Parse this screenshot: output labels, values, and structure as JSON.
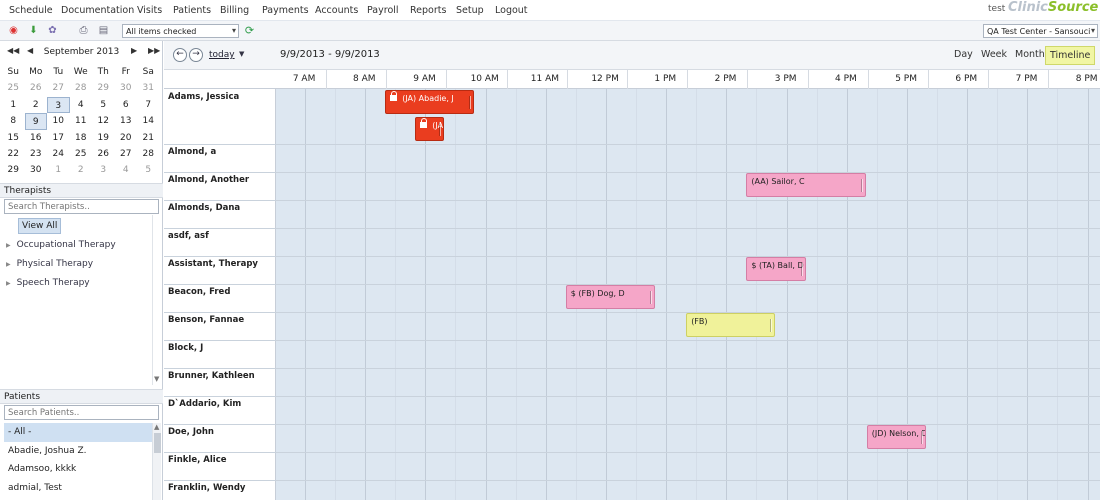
{
  "menu": {
    "items": [
      "Schedule",
      "Documentation",
      "Visits",
      "Patients",
      "Billing",
      "Payments",
      "Accounts",
      "Payroll",
      "Reports",
      "Setup",
      "Logout"
    ]
  },
  "header": {
    "user": "test",
    "logo_part1": "Clinic",
    "logo_part2": "Source"
  },
  "toolbar": {
    "filter_value": "All items checked",
    "center_value": "QA Test Center - Sansouci"
  },
  "calendar": {
    "month_label": "September 2013",
    "day_headers": [
      "Su",
      "Mo",
      "Tu",
      "We",
      "Th",
      "Fr",
      "Sa"
    ],
    "weeks": [
      [
        "25",
        "26",
        "27",
        "28",
        "29",
        "30",
        "31"
      ],
      [
        "1",
        "2",
        "3",
        "4",
        "5",
        "6",
        "7"
      ],
      [
        "8",
        "9",
        "10",
        "11",
        "12",
        "13",
        "14"
      ],
      [
        "15",
        "16",
        "17",
        "18",
        "19",
        "20",
        "21"
      ],
      [
        "22",
        "23",
        "24",
        "25",
        "26",
        "27",
        "28"
      ],
      [
        "29",
        "30",
        "1",
        "2",
        "3",
        "4",
        "5"
      ]
    ]
  },
  "therapists": {
    "heading": "Therapists",
    "search_placeholder": "Search Therapists..",
    "view_all": "View All",
    "groups": [
      "Occupational Therapy",
      "Physical Therapy",
      "Speech Therapy"
    ]
  },
  "patients": {
    "heading": "Patients",
    "search_placeholder": "Search Patients..",
    "items": [
      "- All -",
      "Abadie, Joshua Z.",
      "Adamsoo, kkkk",
      "admial, Test"
    ]
  },
  "schedule": {
    "today_label": "today",
    "date_range": "9/9/2013 - 9/9/2013",
    "views": [
      "Day",
      "Week",
      "Month",
      "Timeline"
    ],
    "active_view": "Timeline",
    "hours": [
      "7 AM",
      "8 AM",
      "9 AM",
      "10 AM",
      "11 AM",
      "12 PM",
      "1 PM",
      "2 PM",
      "3 PM",
      "4 PM",
      "5 PM",
      "6 PM",
      "7 PM",
      "8 PM"
    ],
    "rows": [
      {
        "name": "Adams, Jessica",
        "tall": true
      },
      {
        "name": "Almond, a"
      },
      {
        "name": "Almond, Another"
      },
      {
        "name": "Almonds, Dana"
      },
      {
        "name": "asdf, asf"
      },
      {
        "name": "Assistant, Therapy"
      },
      {
        "name": "Beacon, Fred"
      },
      {
        "name": "Benson, Fannae"
      },
      {
        "name": "Block, J"
      },
      {
        "name": "Brunner, Kathleen"
      },
      {
        "name": "D`Addario, Kim"
      },
      {
        "name": "Doe, John"
      },
      {
        "name": "Finkle, Alice"
      },
      {
        "name": "Franklin, Wendy"
      }
    ],
    "appointments": [
      {
        "row": 0,
        "lane": 0,
        "start": 8.0,
        "end": 9.5,
        "label": "(JA) Abadie, J",
        "color": "red",
        "locked": true
      },
      {
        "row": 0,
        "lane": 1,
        "start": 8.5,
        "end": 9.0,
        "label": "(JA)",
        "color": "red",
        "locked": true
      },
      {
        "row": 2,
        "lane": 0,
        "start": 14.0,
        "end": 16.0,
        "label": "(AA) Sailor, C",
        "color": "pink",
        "locked": false
      },
      {
        "row": 5,
        "lane": 0,
        "start": 14.0,
        "end": 15.0,
        "label": "$ (TA) Ball, D",
        "color": "pink",
        "locked": false
      },
      {
        "row": 6,
        "lane": 0,
        "start": 11.0,
        "end": 12.5,
        "label": "$ (FB) Dog, D",
        "color": "pink",
        "locked": false
      },
      {
        "row": 7,
        "lane": 0,
        "start": 13.0,
        "end": 14.5,
        "label": "(FB)",
        "color": "yellow",
        "locked": false
      },
      {
        "row": 11,
        "lane": 0,
        "start": 16.0,
        "end": 17.0,
        "label": "(JD) Nelson, D",
        "color": "pink",
        "locked": false
      }
    ]
  }
}
